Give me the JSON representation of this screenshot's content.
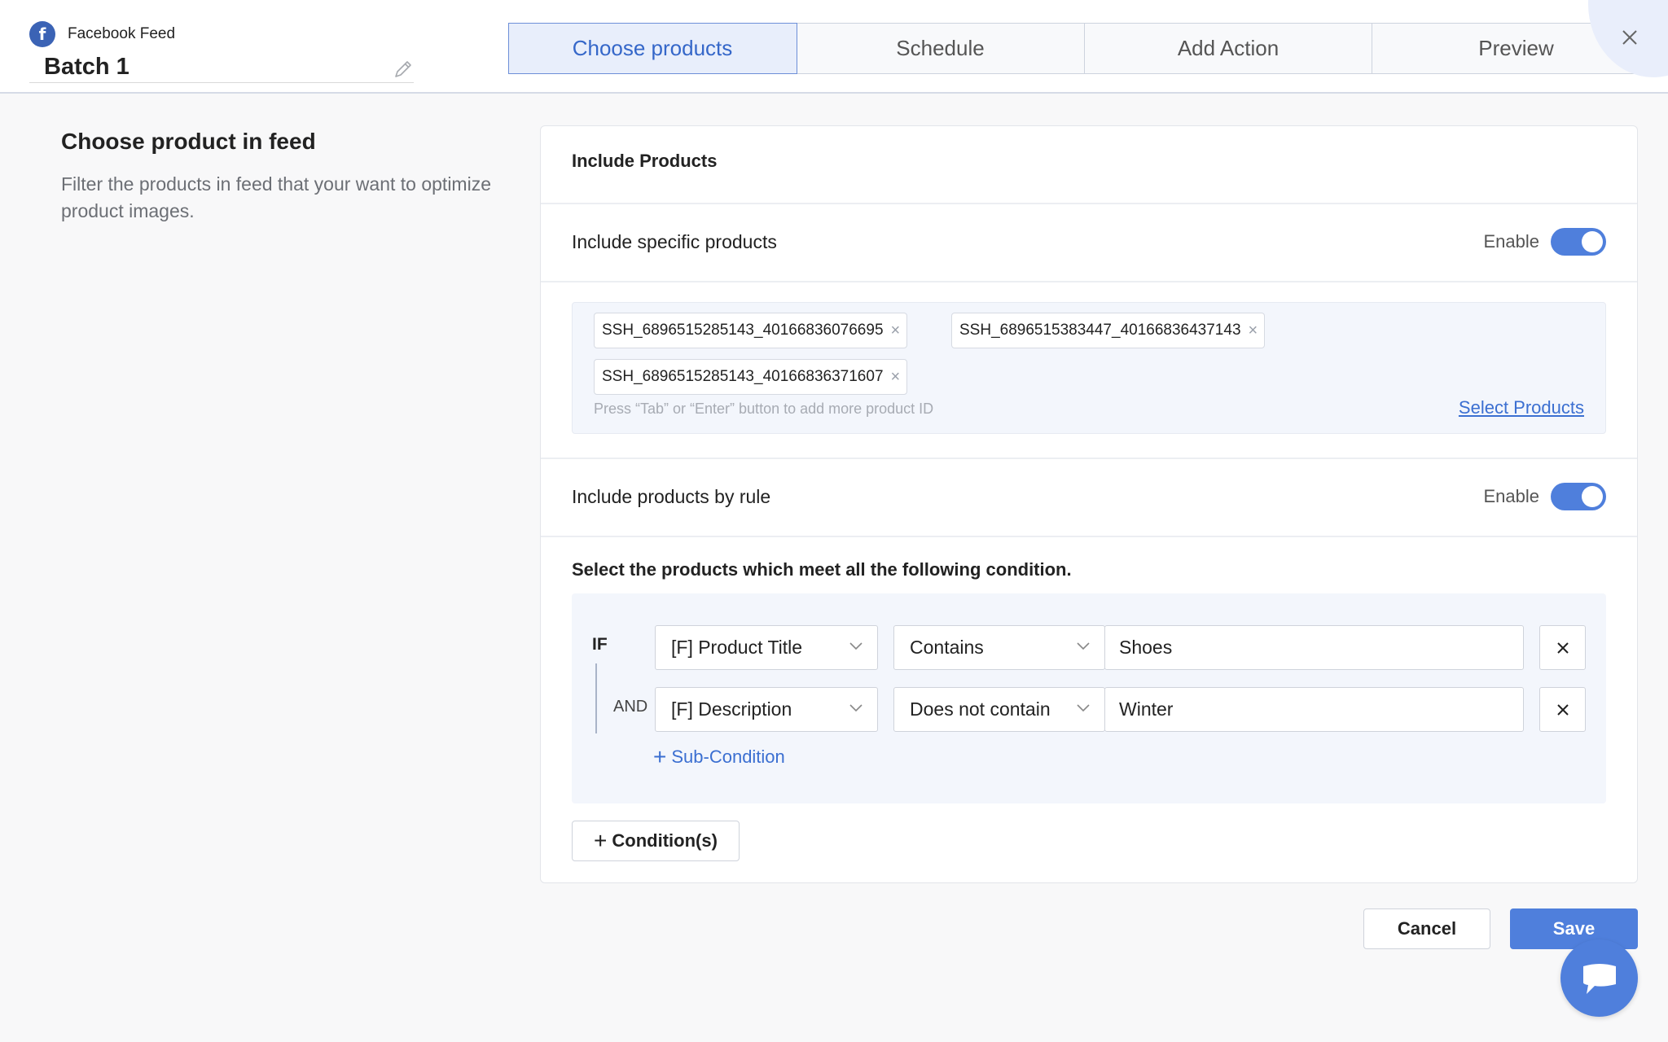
{
  "header": {
    "feed_name": "Facebook Feed",
    "batch_name": "Batch 1",
    "tabs": [
      {
        "label": "Choose products",
        "active": true
      },
      {
        "label": "Schedule",
        "active": false
      },
      {
        "label": "Add Action",
        "active": false
      },
      {
        "label": "Preview",
        "active": false
      }
    ]
  },
  "left": {
    "title": "Choose product in feed",
    "description": "Filter the products in feed that your want to optimize product images."
  },
  "card": {
    "title": "Include Products",
    "specific": {
      "label": "Include specific products",
      "enable_label": "Enable",
      "enabled": true,
      "tags": [
        "SSH_6896515285143_40166836076695",
        "SSH_6896515383447_40166836437143",
        "SSH_6896515285143_40166836371607"
      ],
      "hint": "Press “Tab” or “Enter” button to add more product ID",
      "select_link": "Select Products"
    },
    "by_rule": {
      "label": "Include products by rule",
      "enable_label": "Enable",
      "enabled": true
    },
    "conditions": {
      "heading": "Select the products which meet all the following condition.",
      "if_label": "IF",
      "and_label": "AND",
      "rows": [
        {
          "field": "[F] Product Title",
          "operator": "Contains",
          "value": "Shoes"
        },
        {
          "field": "[F] Description",
          "operator": "Does not contain",
          "value": "Winter"
        }
      ],
      "sub_condition_label": "Sub-Condition",
      "add_condition_label": "Condition(s)"
    }
  },
  "footer": {
    "cancel_label": "Cancel",
    "save_label": "Save"
  },
  "colors": {
    "accent": "#4f7fdc",
    "link": "#3b6fd1",
    "facebook": "#3b63b5"
  }
}
